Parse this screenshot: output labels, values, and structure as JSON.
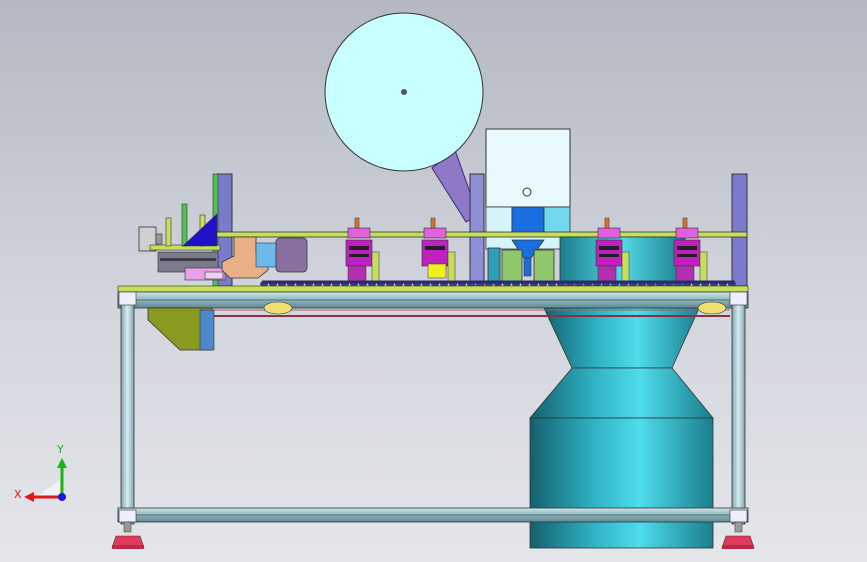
{
  "viewport": {
    "background_top": "#b3b8c2",
    "background_bottom": "#e4e6ea"
  },
  "model": {
    "reel_color": "#c8ffff",
    "frame_color": "#a6c7cf",
    "hopper_color": "#3ab8c8",
    "plate_color": "#c6df5a",
    "foot_color": "#e03a5a",
    "actuator_color": "#c020c0"
  },
  "triad": {
    "x_label": "X",
    "y_label": "Y",
    "x_color": "#e01818",
    "y_color": "#18b418",
    "z_color": "#1818e0"
  }
}
